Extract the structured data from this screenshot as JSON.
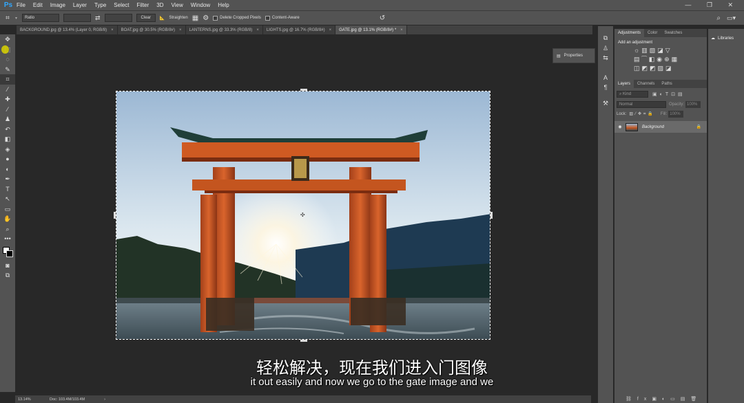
{
  "app": {
    "logo": "Ps"
  },
  "menu": [
    "File",
    "Edit",
    "Image",
    "Layer",
    "Type",
    "Select",
    "Filter",
    "3D",
    "View",
    "Window",
    "Help"
  ],
  "window_controls": "— ❐ ✕",
  "options": {
    "ratio": "Ratio",
    "clear": "Clear",
    "straighten": "Straighten",
    "delete_cropped": "Delete Cropped Pixels",
    "content_aware": "Content-Aware"
  },
  "tabs": [
    {
      "label": "BACKGROUND.jpg @ 13.4% (Layer 0, RGB/8)",
      "active": false
    },
    {
      "label": "BOAT.jpg @ 30.5% (RGB/8#)",
      "active": false
    },
    {
      "label": "LANTERNS.jpg @ 33.3% (RGB/8)",
      "active": false
    },
    {
      "label": "LIGHTS.jpg @ 16.7% (RGB/8#)",
      "active": false
    },
    {
      "label": "GATE.jpg @ 13.1% (RGB/8#) *",
      "active": true
    }
  ],
  "properties_label": "Properties",
  "panel": {
    "top_tabs": [
      "Adjustments",
      "Color",
      "Swatches"
    ],
    "add_adjustment": "Add an adjustment",
    "layer_tabs": [
      "Layers",
      "Channels",
      "Paths"
    ],
    "kind_label": "Kind",
    "blend_mode": "Normal",
    "opacity_label": "Opacity:",
    "opacity_value": "100%",
    "lock_label": "Lock:",
    "fill_label": "Fill:",
    "fill_value": "100%",
    "layer_name": "Background"
  },
  "libraries_label": "Libraries",
  "status": {
    "zoom": "13.14%",
    "doc": "Doc: 103.4M/103.4M",
    "arrow": "›"
  },
  "subtitles": {
    "chinese": "轻松解决，现在我们进入门图像",
    "english": "it out easily and now we go to the gate image and we"
  }
}
